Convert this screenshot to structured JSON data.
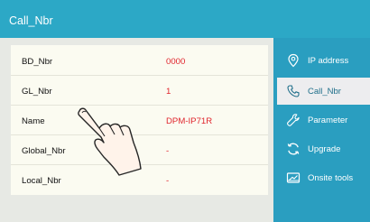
{
  "header": {
    "title": "Call_Nbr"
  },
  "rows": [
    {
      "label": "BD_Nbr",
      "value": "0000"
    },
    {
      "label": "GL_Nbr",
      "value": "1"
    },
    {
      "label": "Name",
      "value": "DPM-IP71R"
    },
    {
      "label": "Global_Nbr",
      "value": "-"
    },
    {
      "label": "Local_Nbr",
      "value": "-"
    }
  ],
  "sidebar": {
    "items": [
      {
        "label": "IP address",
        "icon": "location-pin-icon",
        "active": false
      },
      {
        "label": "Call_Nbr",
        "icon": "phone-icon",
        "active": true
      },
      {
        "label": "Parameter",
        "icon": "wrench-icon",
        "active": false
      },
      {
        "label": "Upgrade",
        "icon": "refresh-icon",
        "active": false
      },
      {
        "label": "Onsite tools",
        "icon": "toolbox-icon",
        "active": false
      }
    ]
  },
  "colors": {
    "header": "#2ca8c6",
    "sidebar": "#2a9ec0",
    "value": "#e0252d"
  }
}
